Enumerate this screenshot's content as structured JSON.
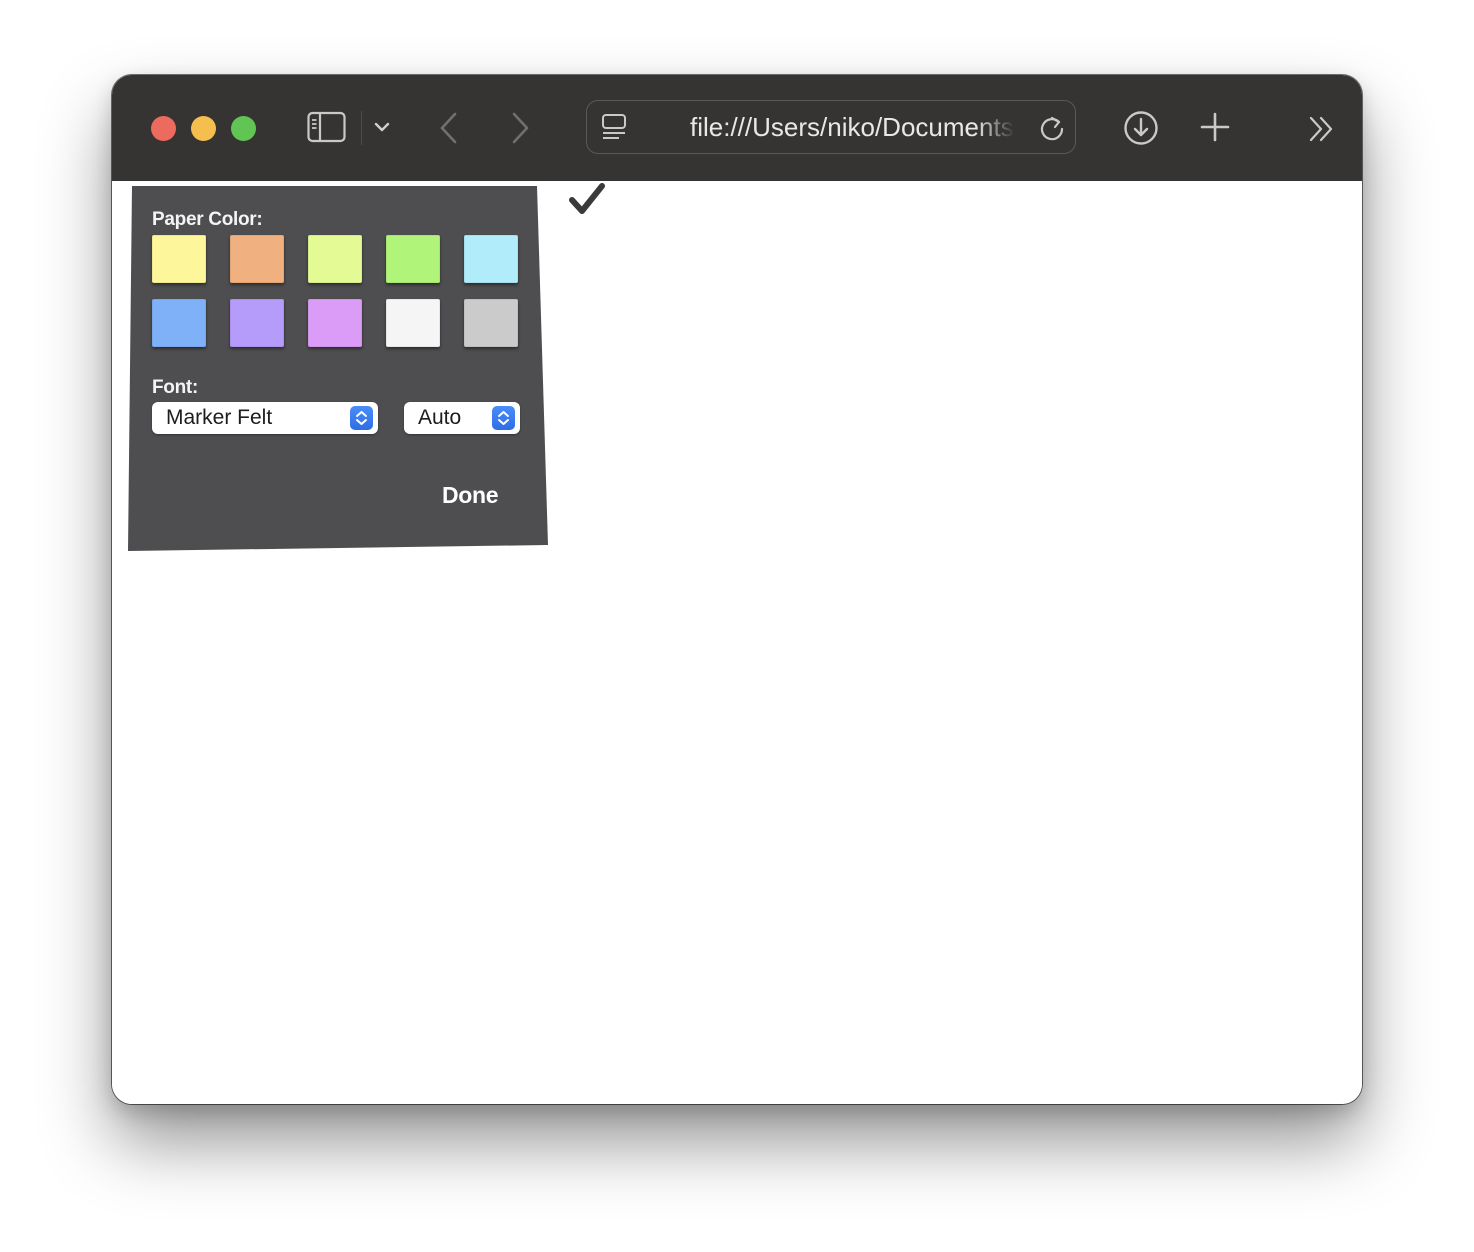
{
  "browser": {
    "url": "file:///Users/niko/Documents/",
    "icons": [
      "sidebar-icon",
      "chevron-down-icon",
      "back-arrow-icon",
      "forward-arrow-icon",
      "reader-icon",
      "reload-icon",
      "download-icon",
      "plus-icon",
      "chevrons-right-icon"
    ]
  },
  "panel": {
    "paper_color_label": "Paper Color:",
    "font_label": "Font:",
    "font_select_value": "Marker Felt",
    "size_select_value": "Auto",
    "done_label": "Done",
    "swatches": [
      {
        "name": "yellow",
        "color": "#fdf69a"
      },
      {
        "name": "orange",
        "color": "#f0b080"
      },
      {
        "name": "lime",
        "color": "#e4fa95"
      },
      {
        "name": "green",
        "color": "#b0f57a"
      },
      {
        "name": "cyan",
        "color": "#b0ecfa"
      },
      {
        "name": "blue",
        "color": "#7fb1f8"
      },
      {
        "name": "purple",
        "color": "#b59cfa"
      },
      {
        "name": "violet",
        "color": "#db9cf8"
      },
      {
        "name": "white",
        "color": "#f5f5f5"
      },
      {
        "name": "gray",
        "color": "#cbcbcb"
      }
    ]
  },
  "content": {
    "checkmark_icon": "checkmark-icon"
  }
}
